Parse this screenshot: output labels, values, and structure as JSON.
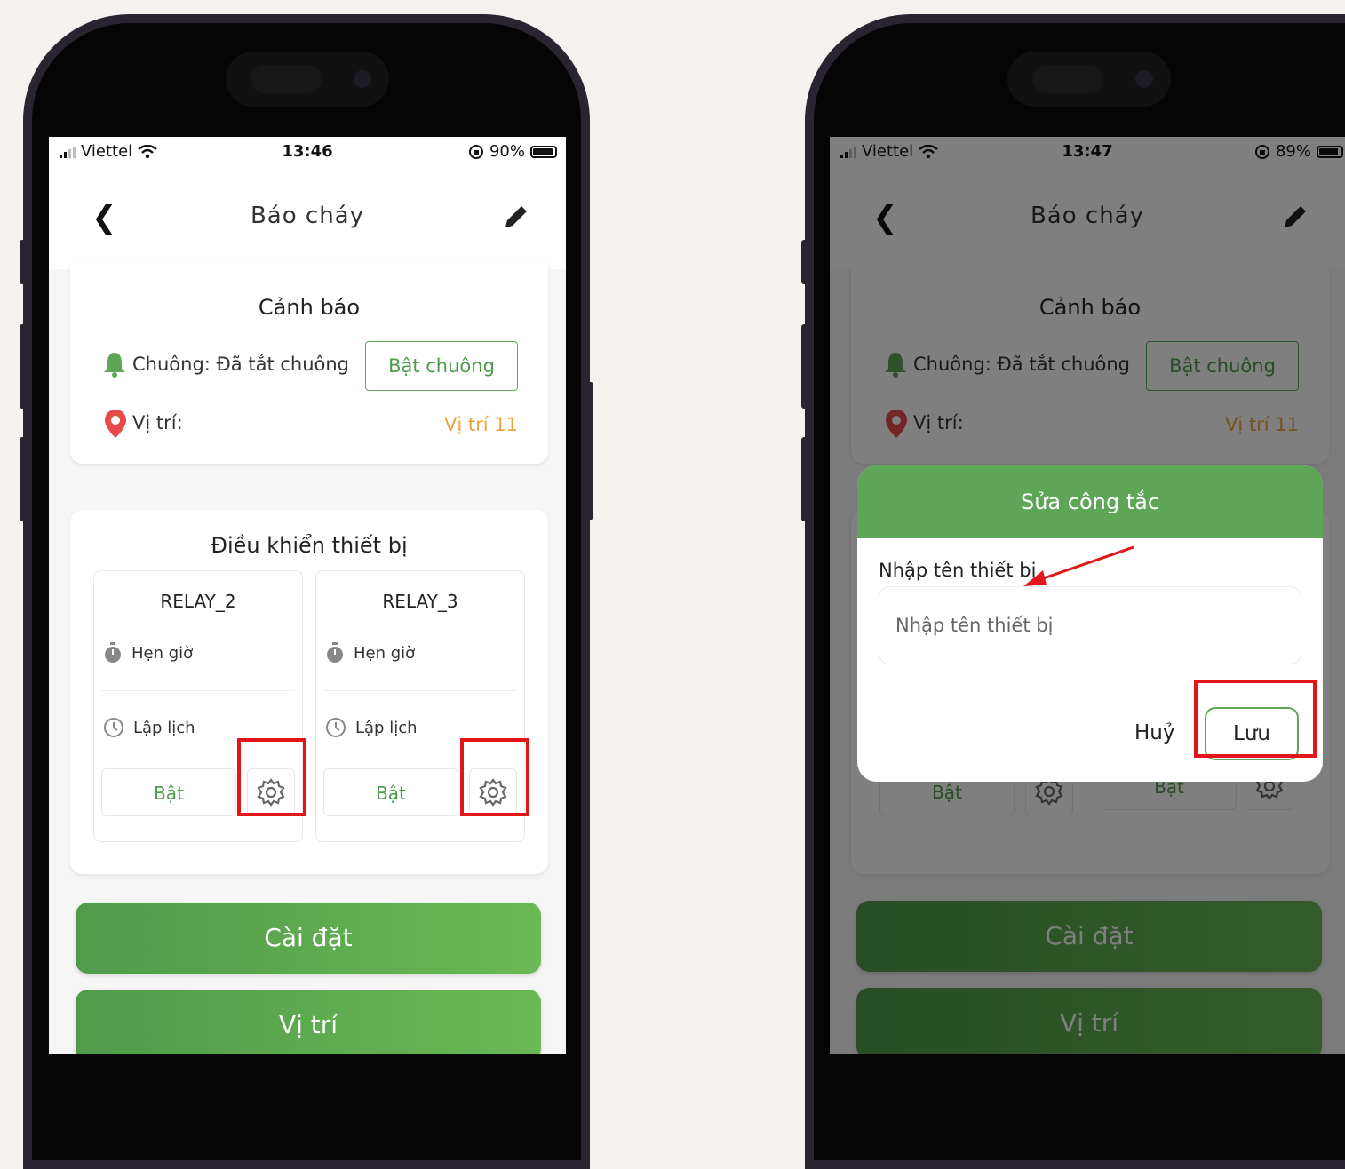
{
  "phone1": {
    "status": {
      "carrier": "Viettel",
      "time": "13:46",
      "battery": "90%",
      "battery_level": 0.9
    },
    "header": {
      "title": "Báo cháy"
    },
    "alert_card": {
      "title": "Cảnh báo",
      "bell_label": "Chuông: Đã tắt chuông",
      "bell_button": "Bật chuông",
      "location_label": "Vị trí:",
      "location_value": "Vị trí 11"
    },
    "control_card": {
      "title": "Điều khiển thiết bị",
      "relays": [
        {
          "name": "RELAY_2",
          "timer": "Hẹn giờ",
          "schedule": "Lập lịch",
          "on": "Bật"
        },
        {
          "name": "RELAY_3",
          "timer": "Hẹn giờ",
          "schedule": "Lập lịch",
          "on": "Bật"
        }
      ]
    },
    "buttons": {
      "settings": "Cài đặt",
      "location": "Vị trí"
    }
  },
  "phone2": {
    "status": {
      "carrier": "Viettel",
      "time": "13:47",
      "battery": "89%",
      "battery_level": 0.89
    },
    "header": {
      "title": "Báo cháy"
    },
    "alert_card": {
      "title": "Cảnh báo",
      "bell_label": "Chuông: Đã tắt chuông",
      "bell_button": "Bật chuông",
      "location_label": "Vị trí:",
      "location_value": "Vị trí 11"
    },
    "background_relays": [
      {
        "on": "Bật"
      },
      {
        "on": "Bật"
      }
    ],
    "buttons": {
      "settings": "Cài đặt",
      "location": "Vị trí"
    },
    "dialog": {
      "title": "Sửa công tắc",
      "label": "Nhập tên thiết bị",
      "placeholder": "Nhập tên thiết bị",
      "cancel": "Huỷ",
      "save": "Lưu"
    }
  },
  "colors": {
    "green": "#5ea558",
    "orange": "#f0a23a",
    "highlight": "#e0161b"
  }
}
